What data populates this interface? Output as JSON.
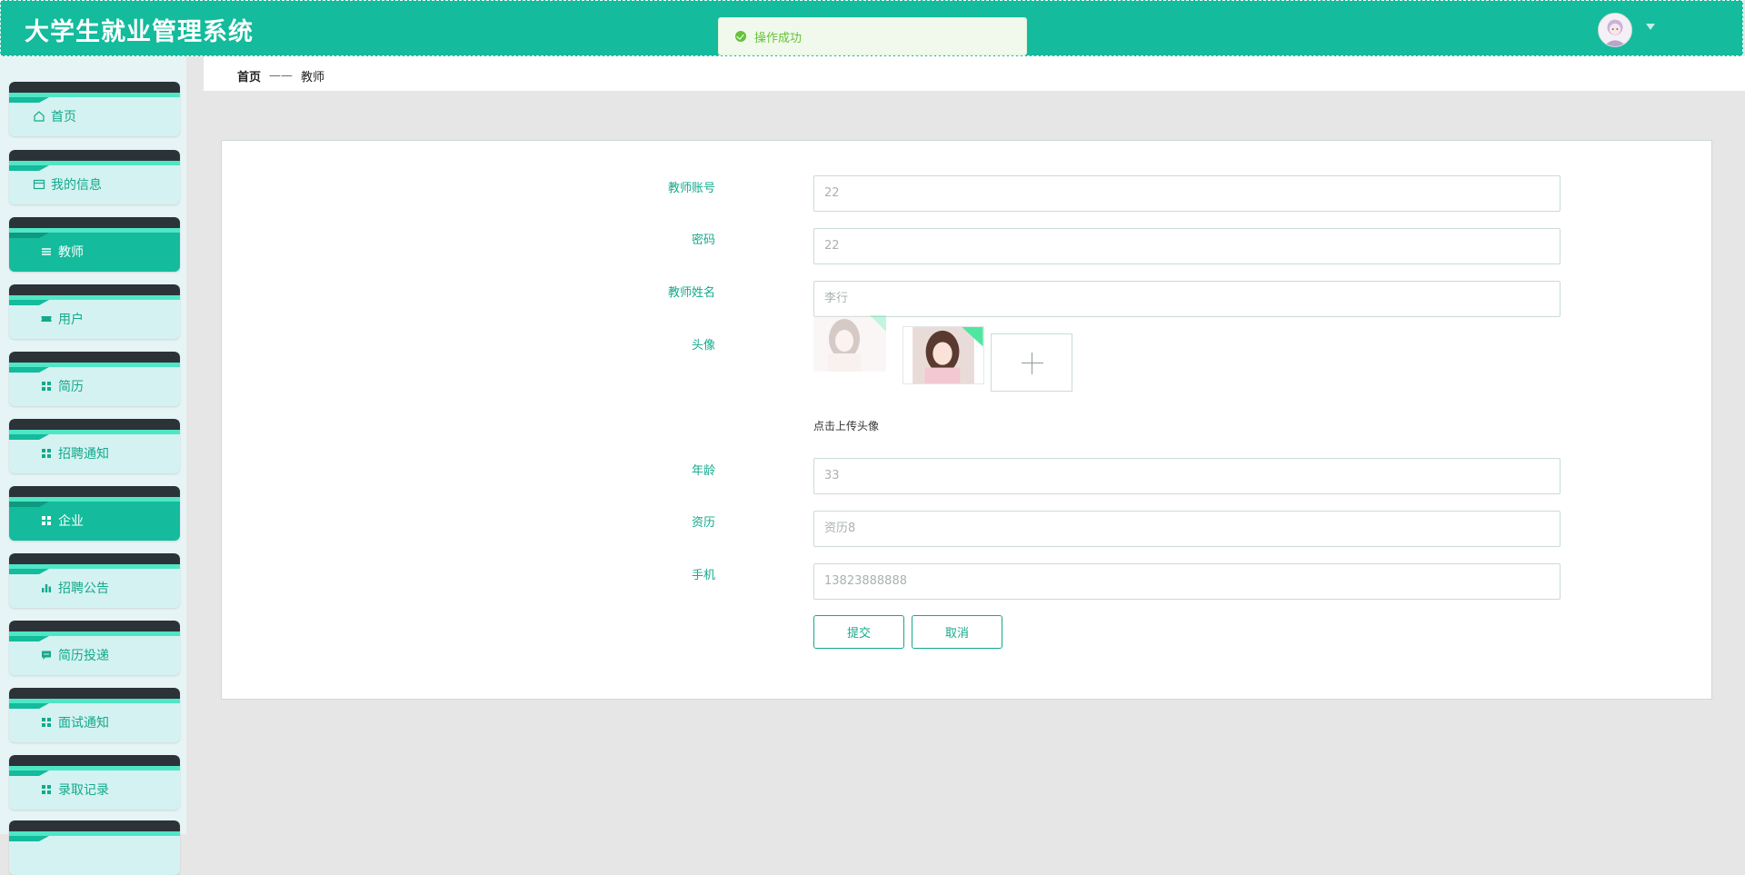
{
  "header": {
    "title": "大学生就业管理系统",
    "user_avatar_icon": "user-avatar",
    "dropdown_icon": "caret-down-icon"
  },
  "toast": {
    "message": "操作成功",
    "icon": "check-circle-icon"
  },
  "sidebar": {
    "items": [
      {
        "label": "首页",
        "icon": "home-icon",
        "active": false
      },
      {
        "label": "我的信息",
        "icon": "card-icon",
        "active": false
      },
      {
        "label": "教师",
        "icon": "list-icon",
        "active": true
      },
      {
        "label": "用户",
        "icon": "ticket-icon",
        "active": false
      },
      {
        "label": "简历",
        "icon": "grid-icon",
        "active": false
      },
      {
        "label": "招聘通知",
        "icon": "grid-icon",
        "active": false
      },
      {
        "label": "企业",
        "icon": "grid-icon",
        "active": true
      },
      {
        "label": "招聘公告",
        "icon": "bar-chart-icon",
        "active": false
      },
      {
        "label": "简历投递",
        "icon": "message-icon",
        "active": false
      },
      {
        "label": "面试通知",
        "icon": "grid-icon",
        "active": false
      },
      {
        "label": "录取记录",
        "icon": "grid-icon",
        "active": false
      }
    ]
  },
  "breadcrumb": {
    "home": "首页",
    "separator": "——",
    "current": "教师"
  },
  "form": {
    "account": {
      "label": "教师账号",
      "value": "22"
    },
    "password": {
      "label": "密码",
      "value": "22"
    },
    "name": {
      "label": "教师姓名",
      "value": "李行"
    },
    "avatar": {
      "label": "头像",
      "hint": "点击上传头像"
    },
    "age": {
      "label": "年龄",
      "value": "33"
    },
    "seniority": {
      "label": "资历",
      "value": "资历8"
    },
    "phone": {
      "label": "手机",
      "value": "13823888888"
    },
    "submit_label": "提交",
    "cancel_label": "取消"
  },
  "colors": {
    "brand": "#14bb9c",
    "success": "#67c23a",
    "menu_bg": "#d4f2f1"
  }
}
